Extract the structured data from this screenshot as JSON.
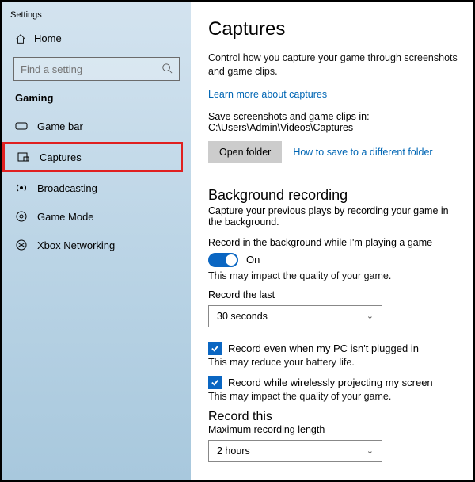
{
  "window_title": "Settings",
  "sidebar": {
    "home": "Home",
    "search_placeholder": "Find a setting",
    "section": "Gaming",
    "items": [
      {
        "label": "Game bar"
      },
      {
        "label": "Captures"
      },
      {
        "label": "Broadcasting"
      },
      {
        "label": "Game Mode"
      },
      {
        "label": "Xbox Networking"
      }
    ]
  },
  "main": {
    "title": "Captures",
    "desc": "Control how you capture your game through screenshots and game clips.",
    "learn_more": "Learn more about captures",
    "save_path_text": "Save screenshots and game clips in: C:\\Users\\Admin\\Videos\\Captures",
    "open_folder": "Open folder",
    "how_to_save": "How to save to a different folder",
    "bg": {
      "heading": "Background recording",
      "sub": "Capture your previous plays by recording your game in the background.",
      "toggle_label": "Record in the background while I'm playing a game",
      "toggle_state": "On",
      "toggle_hint": "This may impact the quality of your game.",
      "record_last_label": "Record the last",
      "record_last_value": "30 seconds",
      "cb1_label": "Record even when my PC isn't plugged in",
      "cb1_hint": "This may reduce your battery life.",
      "cb2_label": "Record while wirelessly projecting my screen",
      "cb2_hint": "This may impact the quality of your game."
    },
    "record_this": {
      "heading": "Record this",
      "max_label": "Maximum recording length",
      "max_value": "2 hours"
    }
  }
}
